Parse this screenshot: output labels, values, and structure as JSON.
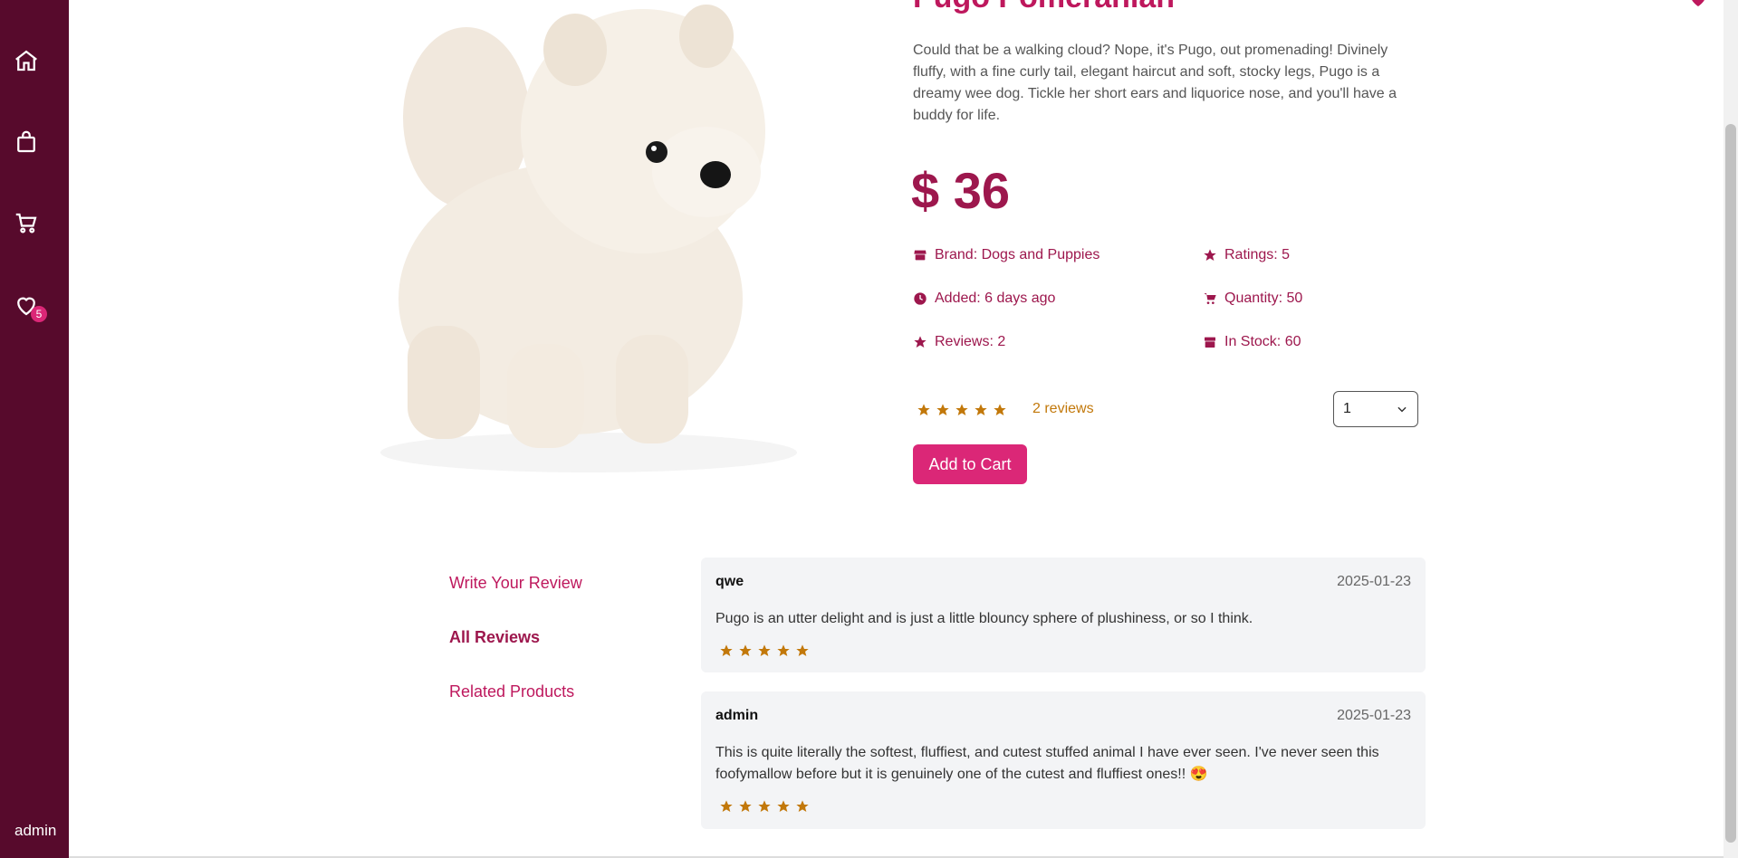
{
  "sidebar": {
    "items": [
      {
        "icon": "home-icon"
      },
      {
        "icon": "shopping-bag-icon"
      },
      {
        "icon": "cart-icon"
      },
      {
        "icon": "heart-icon",
        "badge": "5"
      }
    ],
    "user": "admin"
  },
  "product": {
    "title": "Pugo Pomeranian",
    "description": "Could that be a walking cloud? Nope, it's Pugo, out promenading! Divinely fluffy, with a fine curly tail, elegant haircut and soft, stocky legs, Pugo is a dreamy wee dog. Tickle her short ears and liquorice nose, and you'll have a buddy for life.",
    "price": "$ 36",
    "meta": {
      "brand": "Brand: Dogs and Puppies",
      "ratings": "Ratings: 5",
      "added": "Added: 6 days ago",
      "quantity": "Quantity: 50",
      "reviews": "Reviews: 2",
      "in_stock": "In Stock: 60"
    },
    "rating": 5,
    "reviews_link": "2 reviews",
    "qty_selected": "1",
    "add_to_cart": "Add to Cart"
  },
  "tabs": [
    "Write Your Review",
    "All Reviews",
    "Related Products"
  ],
  "active_tab": "All Reviews",
  "reviews": [
    {
      "user": "qwe",
      "date": "2025-01-23",
      "text": "Pugo is an utter delight and is just a little blouncy sphere of plushiness, or so I think.",
      "rating": 5
    },
    {
      "user": "admin",
      "date": "2025-01-23",
      "text": "This is quite literally the softest, fluffiest, and cutest stuffed animal I have ever seen. I've never seen this foofymallow before but it is genuinely one of the cutest and fluffiest ones!! 😍",
      "rating": 5
    }
  ],
  "colors": {
    "sidebar": "#570a2c",
    "accent": "#db2777",
    "brand_text": "#9d174d",
    "star": "#c2780a"
  }
}
